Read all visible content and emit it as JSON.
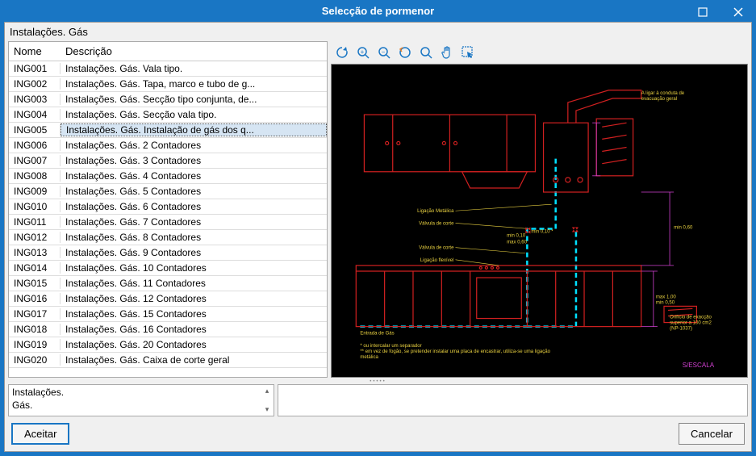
{
  "window": {
    "title": "Selecção de pormenor"
  },
  "breadcrumb": "Instalações. Gás",
  "columns": {
    "nome": "Nome",
    "descricao": "Descrição"
  },
  "selected_index": 4,
  "rows": [
    {
      "nome": "ING001",
      "desc": "Instalações. Gás. Vala tipo."
    },
    {
      "nome": "ING002",
      "desc": "Instalações. Gás. Tapa, marco e tubo de g..."
    },
    {
      "nome": "ING003",
      "desc": "Instalações. Gás. Secção tipo conjunta, de..."
    },
    {
      "nome": "ING004",
      "desc": "Instalações. Gás. Secção vala tipo."
    },
    {
      "nome": "ING005",
      "desc": "Instalações. Gás. Instalação de gás dos q..."
    },
    {
      "nome": "ING006",
      "desc": "Instalações. Gás. 2 Contadores"
    },
    {
      "nome": "ING007",
      "desc": "Instalações. Gás. 3 Contadores"
    },
    {
      "nome": "ING008",
      "desc": "Instalações. Gás. 4 Contadores"
    },
    {
      "nome": "ING009",
      "desc": "Instalações. Gás. 5 Contadores"
    },
    {
      "nome": "ING010",
      "desc": "Instalações. Gás. 6 Contadores"
    },
    {
      "nome": "ING011",
      "desc": "Instalações. Gás. 7 Contadores"
    },
    {
      "nome": "ING012",
      "desc": "Instalações. Gás. 8 Contadores"
    },
    {
      "nome": "ING013",
      "desc": "Instalações. Gás. 9 Contadores"
    },
    {
      "nome": "ING014",
      "desc": "Instalações. Gás. 10 Contadores"
    },
    {
      "nome": "ING015",
      "desc": "Instalações. Gás. 11 Contadores"
    },
    {
      "nome": "ING016",
      "desc": "Instalações. Gás. 12 Contadores"
    },
    {
      "nome": "ING017",
      "desc": "Instalações. Gás. 15 Contadores"
    },
    {
      "nome": "ING018",
      "desc": "Instalações. Gás. 16 Contadores"
    },
    {
      "nome": "ING019",
      "desc": "Instalações. Gás. 20 Contadores"
    },
    {
      "nome": "ING020",
      "desc": "Instalações. Gás. Caixa de corte geral"
    }
  ],
  "detail_text": "Instalações.\nGás.",
  "buttons": {
    "accept": "Aceitar",
    "cancel": "Cancelar"
  },
  "toolbar_icons": [
    "refresh-icon",
    "zoom-extents-icon",
    "zoom-window-icon",
    "redraw-icon",
    "zoom-icon",
    "pan-icon",
    "select-icon"
  ],
  "drawing": {
    "labels": {
      "lig_metalica": "Ligação Metálica",
      "valvula_corte": "Válvula de corte",
      "valvula_corte2": "Válvula de corte",
      "lig_flexivel": "Ligação flexível",
      "entrada": "Entrada de Gás",
      "escala": "S/ESCALA",
      "aligar": "A ligar à conduta de\nevacuação geral",
      "orificio": "Orifício de exacção\nsuperior a 100 cm2\n(NP-1037)",
      "min1": "min 0,10",
      "min2": "min 0,10 *",
      "max": "max 0,60",
      "minh": "min 0,60",
      "max_min_v": "max 1,00\nmin 0,50",
      "note": "* ou intercalar um separador\n** em vez de fogão, se pretender instalar uma placa de encastrar, utiliza-se uma ligação\nmetálica"
    }
  }
}
